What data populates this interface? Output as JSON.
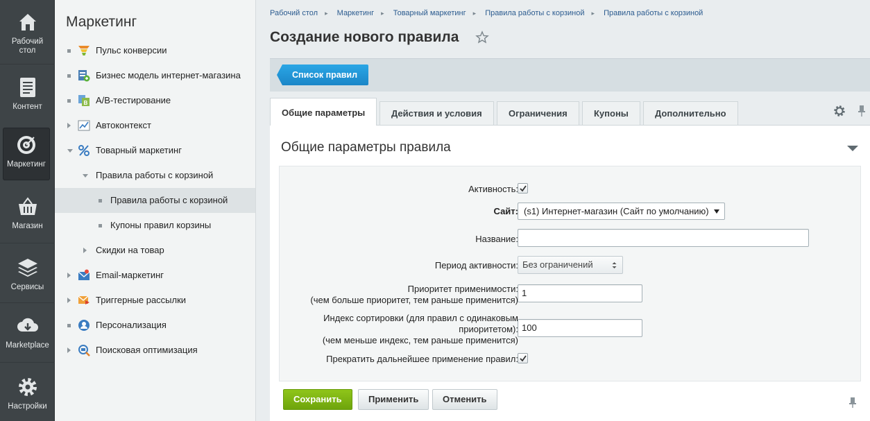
{
  "rail": {
    "items": [
      {
        "label_1": "Рабочий",
        "label_2": "стол",
        "icon": "home-icon"
      },
      {
        "label_1": "Контент",
        "icon": "document-icon"
      },
      {
        "label_1": "Маркетинг",
        "icon": "target-icon"
      },
      {
        "label_1": "Магазин",
        "icon": "basket-icon"
      },
      {
        "label_1": "Сервисы",
        "icon": "layers-icon"
      },
      {
        "label_1": "Marketplace",
        "icon": "cloud-download-icon"
      },
      {
        "label_1": "Настройки",
        "icon": "gear-icon"
      }
    ]
  },
  "sidebar": {
    "title": "Маркетинг",
    "items": [
      {
        "label": "Пульс конверсии",
        "icon": "funnel-icon"
      },
      {
        "label": "Бизнес модель интернет-магазина",
        "icon": "business-model-icon"
      },
      {
        "label": "A/B-тестирование",
        "icon": "ab-test-icon"
      },
      {
        "label": "Автоконтекст",
        "icon": "chart-icon"
      },
      {
        "label": "Товарный маркетинг",
        "icon": "percent-icon"
      },
      {
        "label": "Правила работы с корзиной"
      },
      {
        "label": "Правила работы с корзиной"
      },
      {
        "label": "Купоны правил корзины"
      },
      {
        "label": "Скидки на товар"
      },
      {
        "label": "Email-маркетинг",
        "icon": "email-icon"
      },
      {
        "label": "Триггерные рассылки",
        "icon": "trigger-mail-icon"
      },
      {
        "label": "Персонализация",
        "icon": "person-icon"
      },
      {
        "label": "Поисковая оптимизация",
        "icon": "seo-icon"
      }
    ]
  },
  "breadcrumbs": [
    "Рабочий стол",
    "Маркетинг",
    "Товарный маркетинг",
    "Правила работы с корзиной",
    "Правила работы с корзиной"
  ],
  "page": {
    "title": "Создание нового правила"
  },
  "toolbar": {
    "list_button": "Список правил"
  },
  "tabs": [
    "Общие параметры",
    "Действия и условия",
    "Ограничения",
    "Купоны",
    "Дополнительно"
  ],
  "panel": {
    "title": "Общие параметры правила"
  },
  "form": {
    "active_label": "Активность:",
    "active_checked": true,
    "site_label": "Сайт:",
    "site_value": "(s1) Интернет-магазин (Сайт по умолчанию)",
    "name_label": "Название:",
    "name_value": "",
    "period_label": "Период активности:",
    "period_value": "Без ограничений",
    "priority_label_1": "Приоритет применимости:",
    "priority_label_2": "(чем больше приоритет, тем раньше применится)",
    "priority_value": "1",
    "sort_label_1": "Индекс сортировки (для правил с одинаковым",
    "sort_label_2": "приоритетом):",
    "sort_label_3": "(чем меньше индекс, тем раньше применится)",
    "sort_value": "100",
    "stop_label": "Прекратить дальнейшее применение правил:",
    "stop_checked": true
  },
  "buttons": {
    "save": "Сохранить",
    "apply": "Применить",
    "cancel": "Отменить"
  },
  "colors": {
    "rail_bg": "#3e4447",
    "accent_blue": "#1b86c8",
    "save_green": "#7ab312"
  }
}
